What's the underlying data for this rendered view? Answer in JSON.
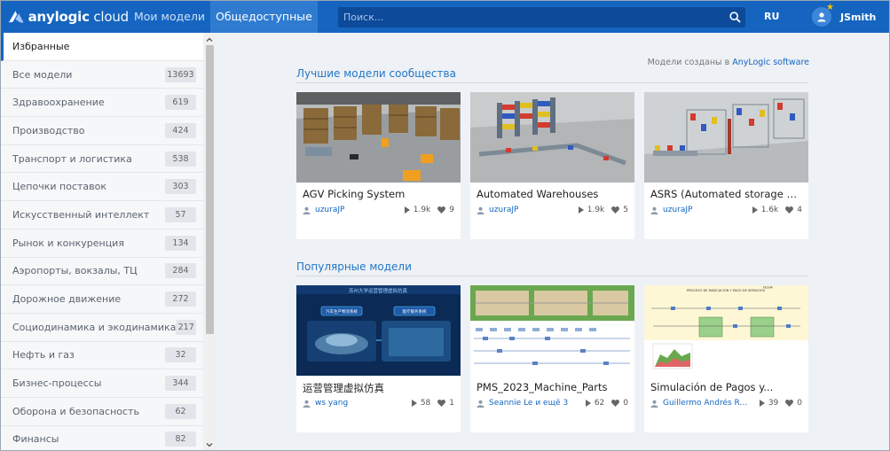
{
  "header": {
    "logo_brand": "anylogic",
    "logo_suffix": "cloud",
    "nav": [
      "Мои модели",
      "Общедоступные"
    ],
    "search_placeholder": "Поиск...",
    "lang": "RU",
    "username": "JSmith"
  },
  "sidebar": {
    "items": [
      {
        "label": "Избранные",
        "count": null
      },
      {
        "label": "Все модели",
        "count": "13693"
      },
      {
        "label": "Здравоохранение",
        "count": "619"
      },
      {
        "label": "Производство",
        "count": "424"
      },
      {
        "label": "Транспорт и логистика",
        "count": "538"
      },
      {
        "label": "Цепочки поставок",
        "count": "303"
      },
      {
        "label": "Искусственный интеллект",
        "count": "57"
      },
      {
        "label": "Рынок и конкуренция",
        "count": "134"
      },
      {
        "label": "Аэропорты, вокзалы, ТЦ",
        "count": "284"
      },
      {
        "label": "Дорожное движение",
        "count": "272"
      },
      {
        "label": "Социодинамика и экодинамика",
        "count": "217"
      },
      {
        "label": "Нефть и газ",
        "count": "32"
      },
      {
        "label": "Бизнес-процессы",
        "count": "344"
      },
      {
        "label": "Оборона и безопасность",
        "count": "62"
      },
      {
        "label": "Финансы",
        "count": "82"
      }
    ]
  },
  "main": {
    "created_prefix": "Модели созданы в",
    "created_link": "AnyLogic software",
    "sections": [
      {
        "title": "Лучшие модели сообщества",
        "cards": [
          {
            "title": "AGV Picking System",
            "author": "uzuraJP",
            "runs": "1.9k",
            "likes": "9"
          },
          {
            "title": "Automated Warehouses",
            "author": "uzuraJP",
            "runs": "1.9k",
            "likes": "5"
          },
          {
            "title": "ASRS (Automated storage and…",
            "author": "uzuraJP",
            "runs": "1.6k",
            "likes": "4"
          }
        ]
      },
      {
        "title": "Популярные модели",
        "cards": [
          {
            "title": "运营管理虚拟仿真",
            "author": "ws yang",
            "runs": "58",
            "likes": "1"
          },
          {
            "title": "PMS_2023_Machine_Parts",
            "author": "Seannie Le и ещё 3",
            "runs": "62",
            "likes": "0"
          },
          {
            "title": "Simulación de Pagos y...",
            "author": "Guillermo Andrés Ruiz Ló...",
            "runs": "39",
            "likes": "0"
          }
        ]
      }
    ],
    "thumb_texts": {
      "chinese_title": "苏州大学运营管理虚拟仿真",
      "chinese_btn1": "汽车生产物流系统",
      "chinese_btn2": "医疗服务系统",
      "pagos_header": "PROCESO DE RADICACION Y PAGO DE SERVICIOS",
      "pagos_fecha": "FECHA"
    }
  }
}
